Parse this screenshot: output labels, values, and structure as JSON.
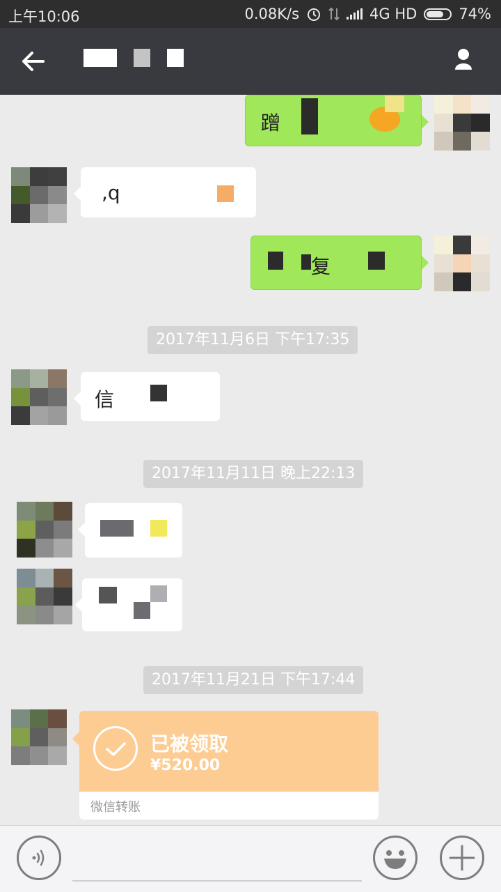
{
  "status_bar": {
    "time": "上午10:06",
    "net_speed": "0.08K/s",
    "network": "4G HD",
    "battery": "74%",
    "battery_level": 0.74
  },
  "header": {
    "back_icon": "arrow-left-icon",
    "profile_icon": "person-icon"
  },
  "messages": {
    "m1_text": "蹭",
    "m2_text": ",q",
    "m3_text": "复",
    "ts1": "2017年11月6日 下午17:35",
    "m4_text": "信",
    "ts2": "2017年11月11日 晚上22:13",
    "ts3": "2017年11月21日 下午17:44",
    "transfer": {
      "status": "已被领取",
      "amount": "¥520.00",
      "label": "微信转账"
    }
  },
  "input_bar": {
    "voice_icon": "voice-icon",
    "emoji_icon": "emoji-icon",
    "add_icon": "plus-icon"
  },
  "colors": {
    "titlebar": "#393a3f",
    "statusbar": "#2e2e2e",
    "chat_bg": "#ebebeb",
    "green_bubble": "#a0e75a",
    "transfer_orange": "#fdcc93",
    "timestamp_bg": "#d4d4d4"
  }
}
